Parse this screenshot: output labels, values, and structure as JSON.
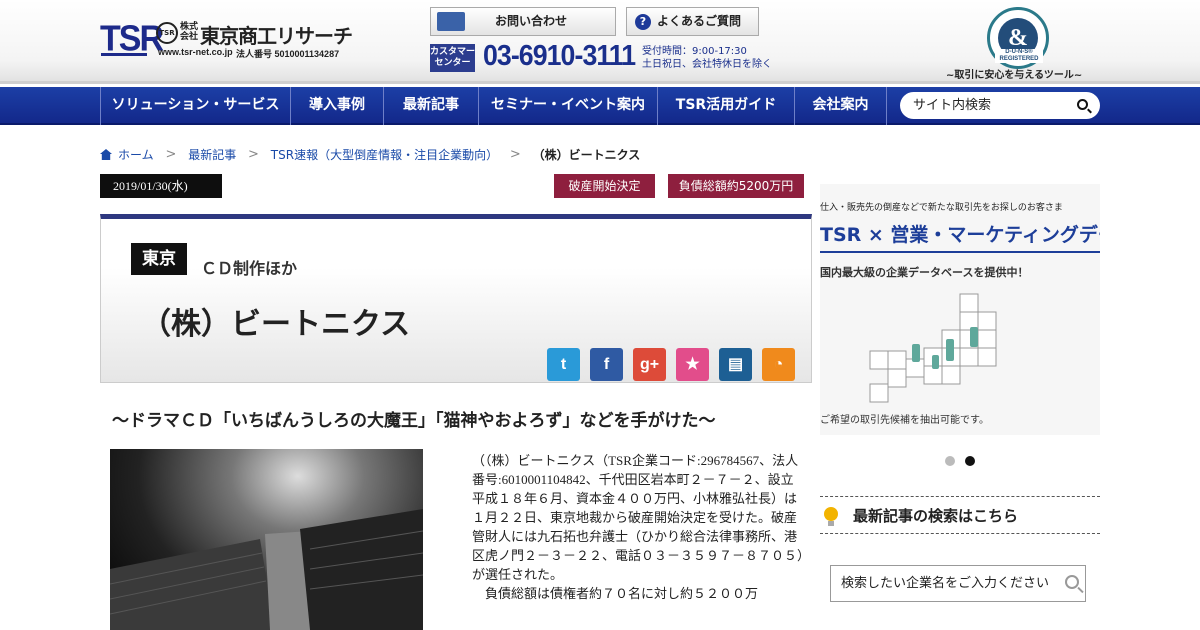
{
  "header": {
    "logo_text": "TSR",
    "logo_mark": "TSR",
    "kaisha": "株式会社",
    "company_name": "東京商工リサーチ",
    "site_url": "www.tsr-net.co.jp",
    "corp_number": "法人番号 5010001134287",
    "contact_label": "お問い合わせ",
    "faq_label": "よくあるご質問",
    "customer_center": "カスタマーセンター",
    "phone": "03-6910-3111",
    "hours_line1": "受付時間：9:00-17:30",
    "hours_line2": "土日祝日、会社特休日を除く",
    "dnb_badge": "D-U-N-S® REGISTERED",
    "dnb_caption": "~取引に安心を与えるツール~"
  },
  "nav": {
    "items": [
      "ソリューション・サービス",
      "導入事例",
      "最新記事",
      "セミナー・イベント案内",
      "TSR活用ガイド",
      "会社案内"
    ],
    "search_placeholder": "サイト内検索"
  },
  "breadcrumb": [
    "ホーム",
    "最新記事",
    "TSR速報（大型倒産情報・注目企業動向）",
    "（株）ビートニクス"
  ],
  "article": {
    "date": "2019/01/30(水)",
    "tags": [
      "破産開始決定",
      "負債総額約5200万円"
    ],
    "prefecture": "東京",
    "industry": "ＣＤ制作ほか",
    "company": "（株）ビートニクス",
    "headline": "～ドラマＣＤ「いちばんうしろの大魔王」「猫神やおよろず」などを手がけた～",
    "body": "（（株）ビートニクス（TSR企業コード:296784567、法人番号:6010001104842、千代田区岩本町２－７－２、設立平成１８年６月、資本金４００万円、小林雅弘社長）は１月２２日、東京地裁から破産開始決定を受けた。破産管財人には九石拓也弁護士（ひかり総合法律事務所、港区虎ノ門２－３－２２、電話０３－３５９７－８７０５）が選任された。",
    "body2": "負債総額は債権者約７０名に対し約５２００万"
  },
  "share": {
    "twitter": "twitter-icon",
    "facebook": "facebook-icon",
    "google": "google-plus-icon",
    "bookmark": "star-icon",
    "print": "print-icon",
    "rss": "rss-icon",
    "colors": [
      "#2a9ad8",
      "#2f5aa3",
      "#dd4b39",
      "#e24d8b",
      "#1d5f94",
      "#f08a1c"
    ]
  },
  "sidebar": {
    "banner_top": "仕入・販売先の倒産などで新たな取引先をお探しのお客さま",
    "banner_title": "TSR × 営業・マーケティングデータ",
    "banner_sub": "国内最大級の企業データベースを提供中！",
    "banner_foot": "ご希望の取引先候補を抽出可能です。",
    "latest_search": "最新記事の検索はこちら",
    "search_placeholder": "検索したい企業名をご入力ください"
  }
}
